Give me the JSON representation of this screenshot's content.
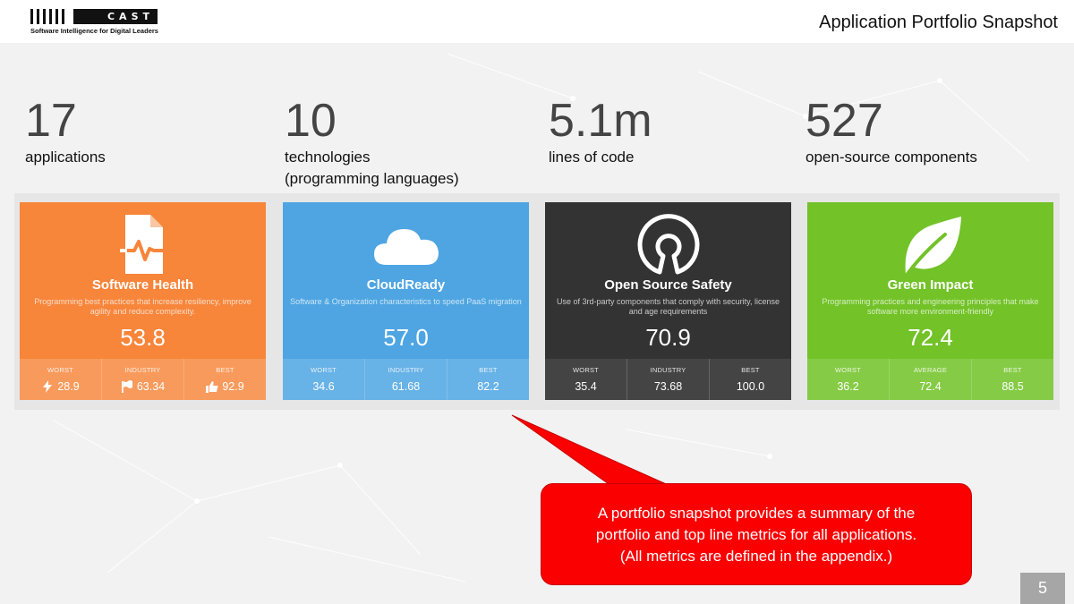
{
  "header": {
    "logo_text": "CAST",
    "logo_tagline": "Software Intelligence for Digital Leaders",
    "page_title": "Application Portfolio Snapshot"
  },
  "stats": [
    {
      "value": "17",
      "label_line1": "applications",
      "label_line2": ""
    },
    {
      "value": "10",
      "label_line1": "technologies",
      "label_line2": "(programming languages)"
    },
    {
      "value": "5.1m",
      "label_line1": "lines of code",
      "label_line2": ""
    },
    {
      "value": "527",
      "label_line1": "open-source components",
      "label_line2": ""
    }
  ],
  "cards": [
    {
      "title": "Software Health",
      "icon": "health-document-icon",
      "color": "#f7853a",
      "description": "Programming best practices that increase resiliency, improve agility and reduce complexity.",
      "score": "53.8",
      "metrics": [
        {
          "label": "WORST",
          "value": "28.9",
          "icon": "lightning-icon"
        },
        {
          "label": "INDUSTRY",
          "value": "63.34",
          "icon": "flag-icon"
        },
        {
          "label": "BEST",
          "value": "92.9",
          "icon": "thumbs-up-icon"
        }
      ]
    },
    {
      "title": "CloudReady",
      "icon": "cloud-icon",
      "color": "#4ea5e2",
      "description": "Software & Organization characteristics to speed PaaS migration",
      "score": "57.0",
      "metrics": [
        {
          "label": "WORST",
          "value": "34.6"
        },
        {
          "label": "INDUSTRY",
          "value": "61.68"
        },
        {
          "label": "BEST",
          "value": "82.2"
        }
      ]
    },
    {
      "title": "Open Source Safety",
      "icon": "open-source-icon",
      "color": "#333333",
      "description": "Use of 3rd-party components that comply with security, license and age requirements",
      "score": "70.9",
      "metrics": [
        {
          "label": "WORST",
          "value": "35.4"
        },
        {
          "label": "INDUSTRY",
          "value": "73.68"
        },
        {
          "label": "BEST",
          "value": "100.0"
        }
      ]
    },
    {
      "title": "Green Impact",
      "icon": "leaf-icon",
      "color": "#72c228",
      "description": "Programming practices and engineering principles that make software more environment-friendly",
      "score": "72.4",
      "metrics": [
        {
          "label": "WORST",
          "value": "36.2"
        },
        {
          "label": "AVERAGE",
          "value": "72.4"
        },
        {
          "label": "BEST",
          "value": "88.5"
        }
      ]
    }
  ],
  "callout": {
    "line1": "A portfolio snapshot provides a summary of the",
    "line2": "portfolio and top line metrics for all applications.",
    "line3": "(All metrics are defined in the appendix.)",
    "color": "#fb0000"
  },
  "page_number": "5"
}
